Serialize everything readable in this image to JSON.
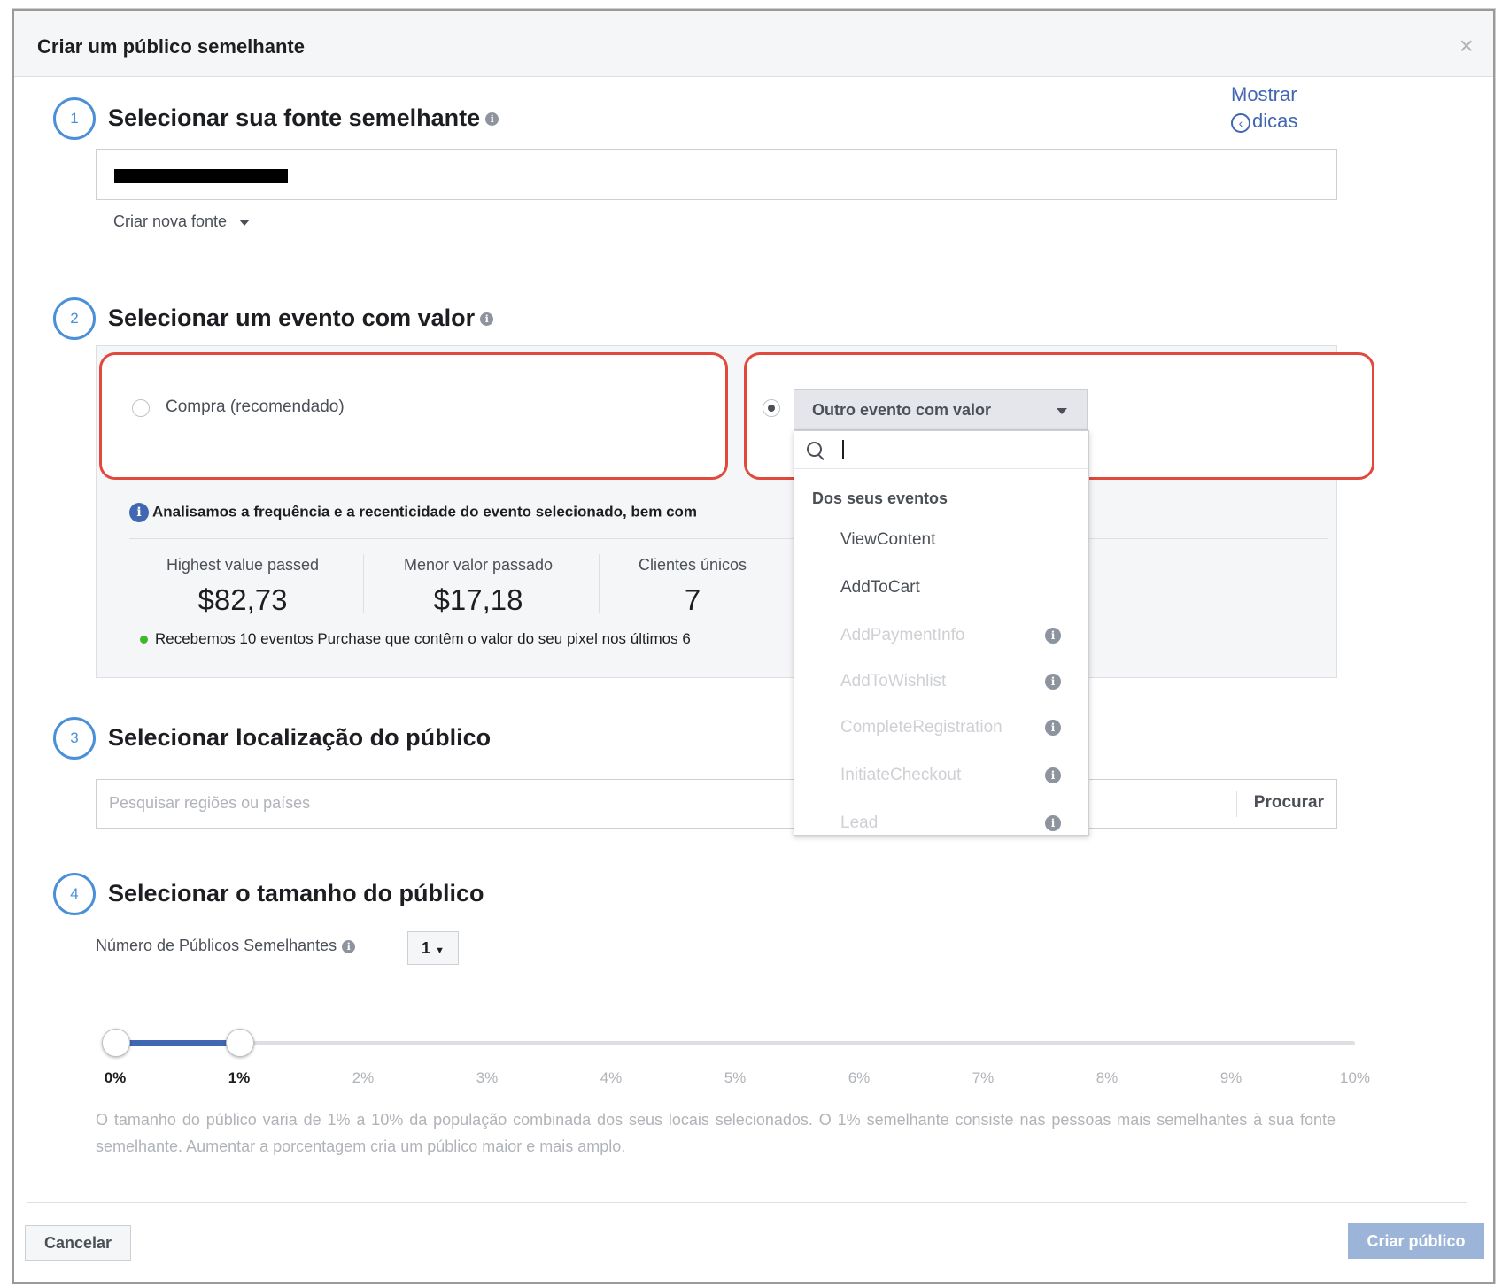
{
  "dialog": {
    "title": "Criar um público semelhante",
    "close_label": "×"
  },
  "tips": {
    "line1": "Mostrar",
    "line2": "dicas"
  },
  "steps": [
    {
      "number": "1",
      "title": "Selecionar sua fonte semelhante"
    },
    {
      "number": "2",
      "title": "Selecionar um evento com valor"
    },
    {
      "number": "3",
      "title": "Selecionar localização do público"
    },
    {
      "number": "4",
      "title": "Selecionar o tamanho do público"
    }
  ],
  "source": {
    "create_new_label": "Criar nova fonte"
  },
  "event": {
    "option_purchase": "Compra (recomendado)",
    "option_other_dropdown": "Outro evento com valor",
    "selected_option": "other",
    "info_text": "Analisamos a frequência e a recenticidade do evento selecionado, bem com",
    "stats": [
      {
        "label": "Highest value passed",
        "value": "$82,73"
      },
      {
        "label": "Menor valor passado",
        "value": "$17,18"
      },
      {
        "label": "Clientes únicos",
        "value": "7"
      }
    ],
    "received_text": "Recebemos 10 eventos Purchase que contêm o valor do seu pixel nos últimos 6"
  },
  "menu": {
    "group_label": "Dos seus eventos",
    "items": [
      {
        "label": "ViewContent",
        "enabled": true
      },
      {
        "label": "AddToCart",
        "enabled": true
      },
      {
        "label": "AddPaymentInfo",
        "enabled": false
      },
      {
        "label": "AddToWishlist",
        "enabled": false
      },
      {
        "label": "CompleteRegistration",
        "enabled": false
      },
      {
        "label": "InitiateCheckout",
        "enabled": false
      },
      {
        "label": "Lead",
        "enabled": false
      }
    ]
  },
  "location": {
    "placeholder": "Pesquisar regiões ou países",
    "search_button": "Procurar"
  },
  "size": {
    "count_label": "Número de Públicos Semelhantes",
    "count_value": "1",
    "slider_range_percent": [
      0,
      1
    ],
    "ticks": [
      "0%",
      "1%",
      "2%",
      "3%",
      "4%",
      "5%",
      "6%",
      "7%",
      "8%",
      "9%",
      "10%"
    ],
    "description": "O tamanho do público varia de 1% a 10% da população combinada dos seus locais selecionados. O 1% semelhante consiste nas pessoas mais semelhantes à sua fonte semelhante. Aumentar a porcentagem cria um público maior e mais amplo."
  },
  "footer": {
    "cancel_label": "Cancelar",
    "create_label": "Criar público"
  },
  "colors": {
    "accent": "#4267b2",
    "step_circle": "#4a90d9",
    "highlight_border": "#e0493c",
    "create_disabled": "#9cb4d8"
  }
}
